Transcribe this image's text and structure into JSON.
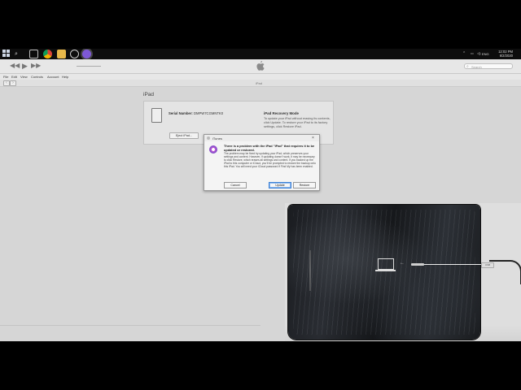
{
  "taskbar": {
    "lang": "ENG",
    "time": "12:02 PM",
    "date": "6/2/2020",
    "icons": [
      "windows-start-icon",
      "search-icon",
      "task-view-icon",
      "chrome-icon",
      "file-explorer-icon",
      "clock-app-icon",
      "itunes-icon"
    ]
  },
  "toolbar": {
    "back_glyph": "◀◀",
    "play_glyph": "▶",
    "forward_glyph": "▶▶",
    "search_placeholder": "Search"
  },
  "menubar": {
    "items": [
      "File",
      "Edit",
      "View",
      "Controls",
      "Account",
      "Help"
    ]
  },
  "nav": {
    "title": "iPad",
    "back": "‹",
    "forward": "›"
  },
  "summary": {
    "device_name": "iPad",
    "serial_label": "Serial Number:",
    "serial_value": "DMPW7CGMNTK0",
    "eject_label": "Eject iPad...",
    "recovery_title": "iPad Recovery Mode",
    "recovery_text": "To update your iPad without erasing its contents, click Update. To restore your iPad to its factory settings, click Restore iPad."
  },
  "dialog": {
    "title": "iTunes",
    "close": "×",
    "heading": "There is a problem with the iPad \"iPad\" that requires it to be updated or restored.",
    "body": "The problem may be fixed by updating your iPad, which preserves your settings and content. However, if updating doesn't work, it may be necessary to click Restore, which erases all settings and content. If you backed up the iPad to this computer or iCloud, you'll be prompted to restore the backup onto this iPad. You will need your iCloud password if Find My has been enabled.",
    "cancel_label": "Cancel",
    "update_label": "Update",
    "restore_label": "Restore"
  },
  "photo": {
    "usb_label": "USB"
  }
}
